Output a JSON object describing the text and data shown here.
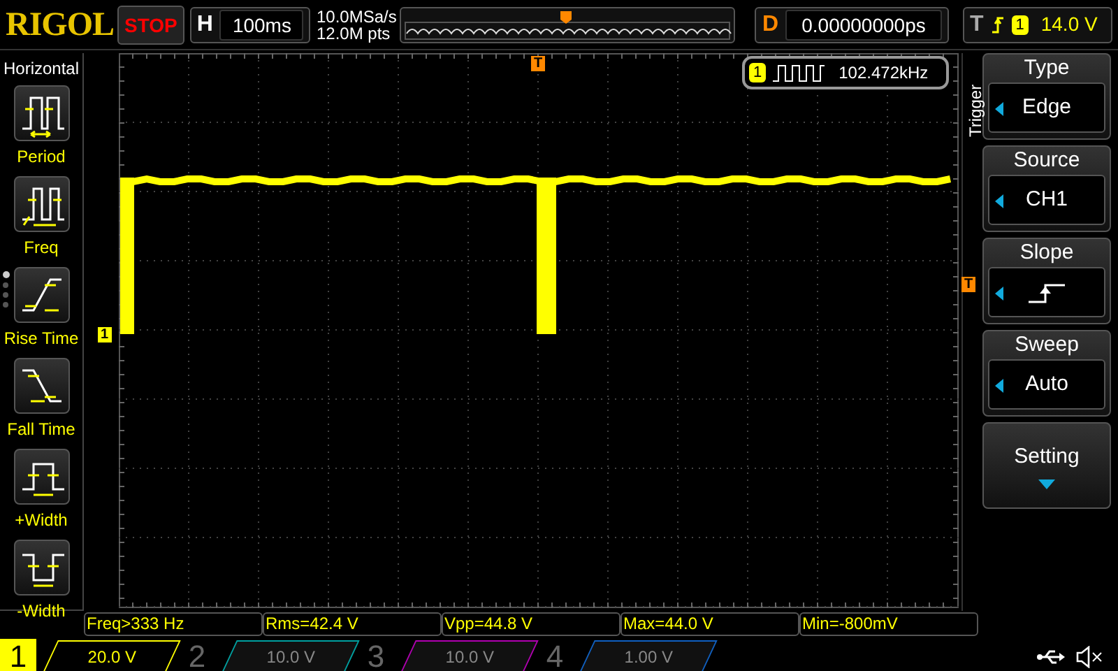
{
  "header": {
    "logo": "RIGOL",
    "run_state": "STOP",
    "timebase_label": "H",
    "timebase": "100ms",
    "sample_rate": "10.0MSa/s",
    "memory_depth": "12.0M pts",
    "delay_label": "D",
    "delay": "0.00000000ps",
    "trigger_label": "T",
    "trigger_channel": "1",
    "trigger_level": "14.0 V"
  },
  "left_menu": {
    "title": "Horizontal",
    "items": [
      {
        "label": "Period",
        "kind": "period"
      },
      {
        "label": "Freq",
        "kind": "freq"
      },
      {
        "label": "Rise Time",
        "kind": "rise"
      },
      {
        "label": "Fall Time",
        "kind": "fall"
      },
      {
        "label": "+Width",
        "kind": "pwidth"
      },
      {
        "label": "-Width",
        "kind": "nwidth"
      }
    ],
    "pages": [
      {
        "selected": true
      },
      {
        "selected": false
      },
      {
        "selected": false
      },
      {
        "selected": false
      }
    ]
  },
  "plot": {
    "counter_channel": "1",
    "counter_value": "102.472kHz",
    "channel_marker": "1",
    "trigger_marker": "T",
    "position_marker": "T"
  },
  "right_menu": {
    "title": "Trigger",
    "items": [
      {
        "label": "Type",
        "value": "Edge",
        "kind": "select"
      },
      {
        "label": "Source",
        "value": "CH1",
        "kind": "select"
      },
      {
        "label": "Slope",
        "kind": "slope"
      },
      {
        "label": "Sweep",
        "value": "Auto",
        "kind": "select"
      },
      {
        "label": "Setting",
        "kind": "submenu"
      }
    ]
  },
  "measurements": [
    "Freq>333 Hz",
    "Rms=42.4 V",
    "Vpp=44.8 V",
    "Max=44.0 V",
    "Min=-800mV"
  ],
  "channels": [
    {
      "number": "1",
      "scale": "20.0 V",
      "on": true,
      "color": "#ffff00"
    },
    {
      "number": "2",
      "scale": "10.0 V",
      "on": false,
      "color": "#00a0a0"
    },
    {
      "number": "3",
      "scale": "10.0 V",
      "on": false,
      "color": "#b000b0"
    },
    {
      "number": "4",
      "scale": "1.00 V",
      "on": false,
      "color": "#1060c0"
    }
  ]
}
